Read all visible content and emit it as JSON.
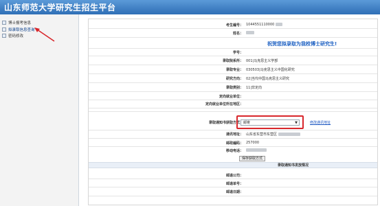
{
  "header": {
    "title": "山东师范大学研究生招生平台"
  },
  "sidebar": {
    "items": [
      {
        "label": "博士报考信息"
      },
      {
        "label": "拟录取信息查询"
      },
      {
        "label": "密码修改"
      }
    ]
  },
  "form": {
    "exam_no": {
      "label": "考生编号：",
      "value": "1044551110000"
    },
    "name": {
      "label": "姓名："
    },
    "congrats": "祝贺您拟录取为我校博士研究生!",
    "student_id": {
      "label": "学号：",
      "value": ""
    },
    "department": {
      "label": "录取院系所：",
      "value": "001|马克思主义学部"
    },
    "major": {
      "label": "录取专业：",
      "value": "030503|马克思主义中国化研究"
    },
    "direction": {
      "label": "研究方向：",
      "value": "02|当代中国马克思主义研究"
    },
    "category": {
      "label": "录取类别：",
      "value": "11|非定向"
    },
    "employer": {
      "label": "定向就业单位：",
      "value": ""
    },
    "employer_location": {
      "label": "定向就业单位所在地区：",
      "value": ""
    },
    "notice_method": {
      "label": "录取通知书获取方式：",
      "selected": "邮寄",
      "modify_link": "修改通讯地址"
    },
    "address": {
      "label": "通讯地址：",
      "value": "山东省东营市东营区"
    },
    "postcode": {
      "label": "邮政编码：",
      "value": "257000"
    },
    "phone": {
      "label": "移动电话："
    },
    "save_button": "保存获取方式",
    "section_title": "录取通知书发放情况",
    "mail_company": {
      "label": "邮递公司："
    },
    "mail_no": {
      "label": "邮递单号："
    },
    "mail_date": {
      "label": "邮递日期："
    }
  },
  "colors": {
    "accent": "#2f6fb6",
    "highlight": "#d8262b",
    "congrats": "#1b5fc2"
  }
}
